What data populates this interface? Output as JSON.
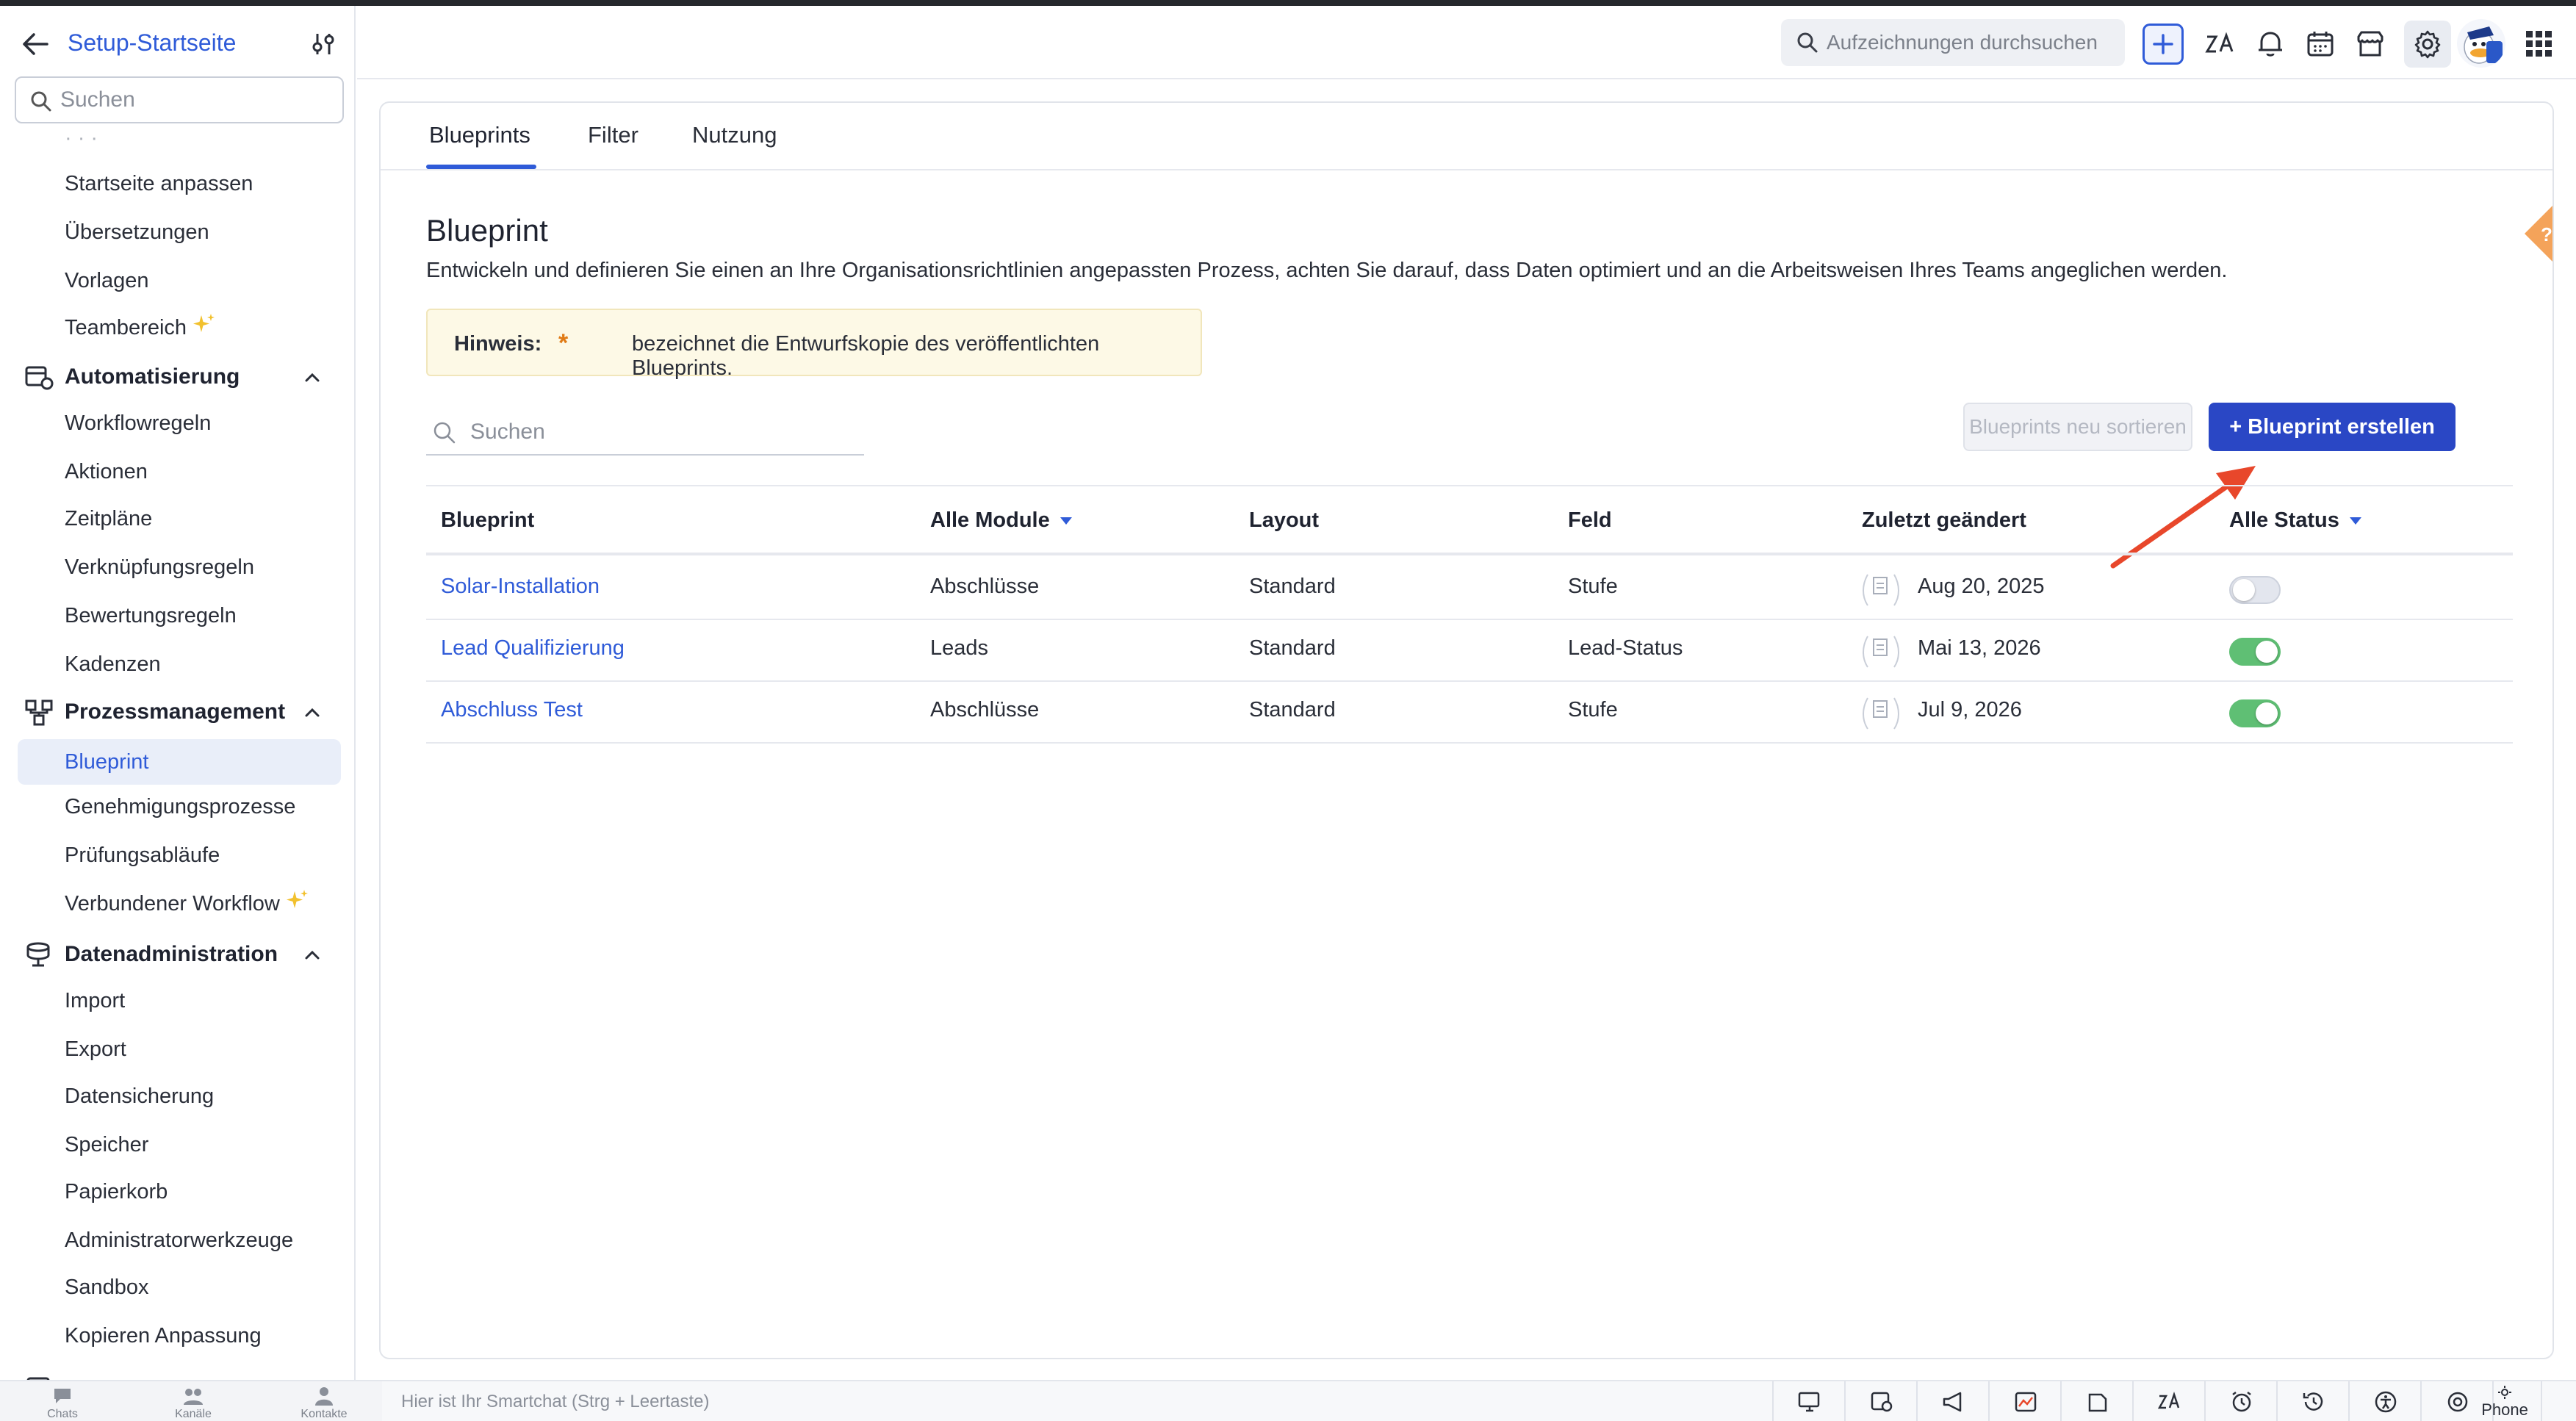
{
  "sidebar": {
    "title": "Setup-Startseite",
    "search_placeholder": "Suchen",
    "items_top": [
      {
        "label": "Startseite anpassen"
      },
      {
        "label": "Übersetzungen"
      },
      {
        "label": "Vorlagen"
      },
      {
        "label": "Teambereich"
      }
    ],
    "automation": {
      "title": "Automatisierung",
      "items": [
        "Workflowregeln",
        "Aktionen",
        "Zeitpläne",
        "Verknüpfungsregeln",
        "Bewertungsregeln",
        "Kadenzen"
      ]
    },
    "process": {
      "title": "Prozessmanagement",
      "items": [
        "Blueprint",
        "Genehmigungsprozesse",
        "Prüfungsabläufe",
        "Verbundener Workflow"
      ]
    },
    "data_admin": {
      "title": "Datenadministration",
      "items": [
        "Import",
        "Export",
        "Datensicherung",
        "Speicher",
        "Papierkorb",
        "Administratorwerkzeuge",
        "Sandbox",
        "Kopieren Anpassung"
      ]
    },
    "bottom_tabs": [
      "Chats",
      "Kanäle",
      "Kontakte"
    ]
  },
  "topbar": {
    "search_placeholder": "Aufzeichnungen durchsuchen"
  },
  "tabs": [
    "Blueprints",
    "Filter",
    "Nutzung"
  ],
  "page": {
    "title": "Blueprint",
    "description": "Entwickeln und definieren Sie einen an Ihre Organisationsrichtlinien angepassten Prozess, achten Sie darauf, dass Daten optimiert und an die Arbeitsweisen Ihres Teams angeglichen werden.",
    "hint_label": "Hinweis:",
    "hint_star": "*",
    "hint_text": "bezeichnet die Entwurfskopie des veröffentlichten Blueprints.",
    "search_placeholder": "Suchen",
    "sort_button": "Blueprints neu sortieren",
    "create_button": "+ Blueprint erstellen"
  },
  "table": {
    "headers": [
      "Blueprint",
      "Alle Module",
      "Layout",
      "Feld",
      "Zuletzt geändert",
      "Alle Status"
    ],
    "rows": [
      {
        "name": "Solar-Installation",
        "module": "Abschlüsse",
        "layout": "Standard",
        "field": "Stufe",
        "modified": "Aug 20, 2025",
        "active": false
      },
      {
        "name": "Lead Qualifizierung",
        "module": "Leads",
        "layout": "Standard",
        "field": "Lead-Status",
        "modified": "Mai 13, 2026",
        "active": true
      },
      {
        "name": "Abschluss Test",
        "module": "Abschlüsse",
        "layout": "Standard",
        "field": "Stufe",
        "modified": "Jul 9, 2026",
        "active": true
      }
    ]
  },
  "bottombar": {
    "smartchat": "Hier ist Ihr Smartchat (Strg + Leertaste)",
    "phone": "Phone"
  },
  "colors": {
    "accent": "#2f5bd8",
    "primary_button": "#2a47c5",
    "toggle_on": "#5fbf74",
    "arrow": "#e8472b"
  }
}
